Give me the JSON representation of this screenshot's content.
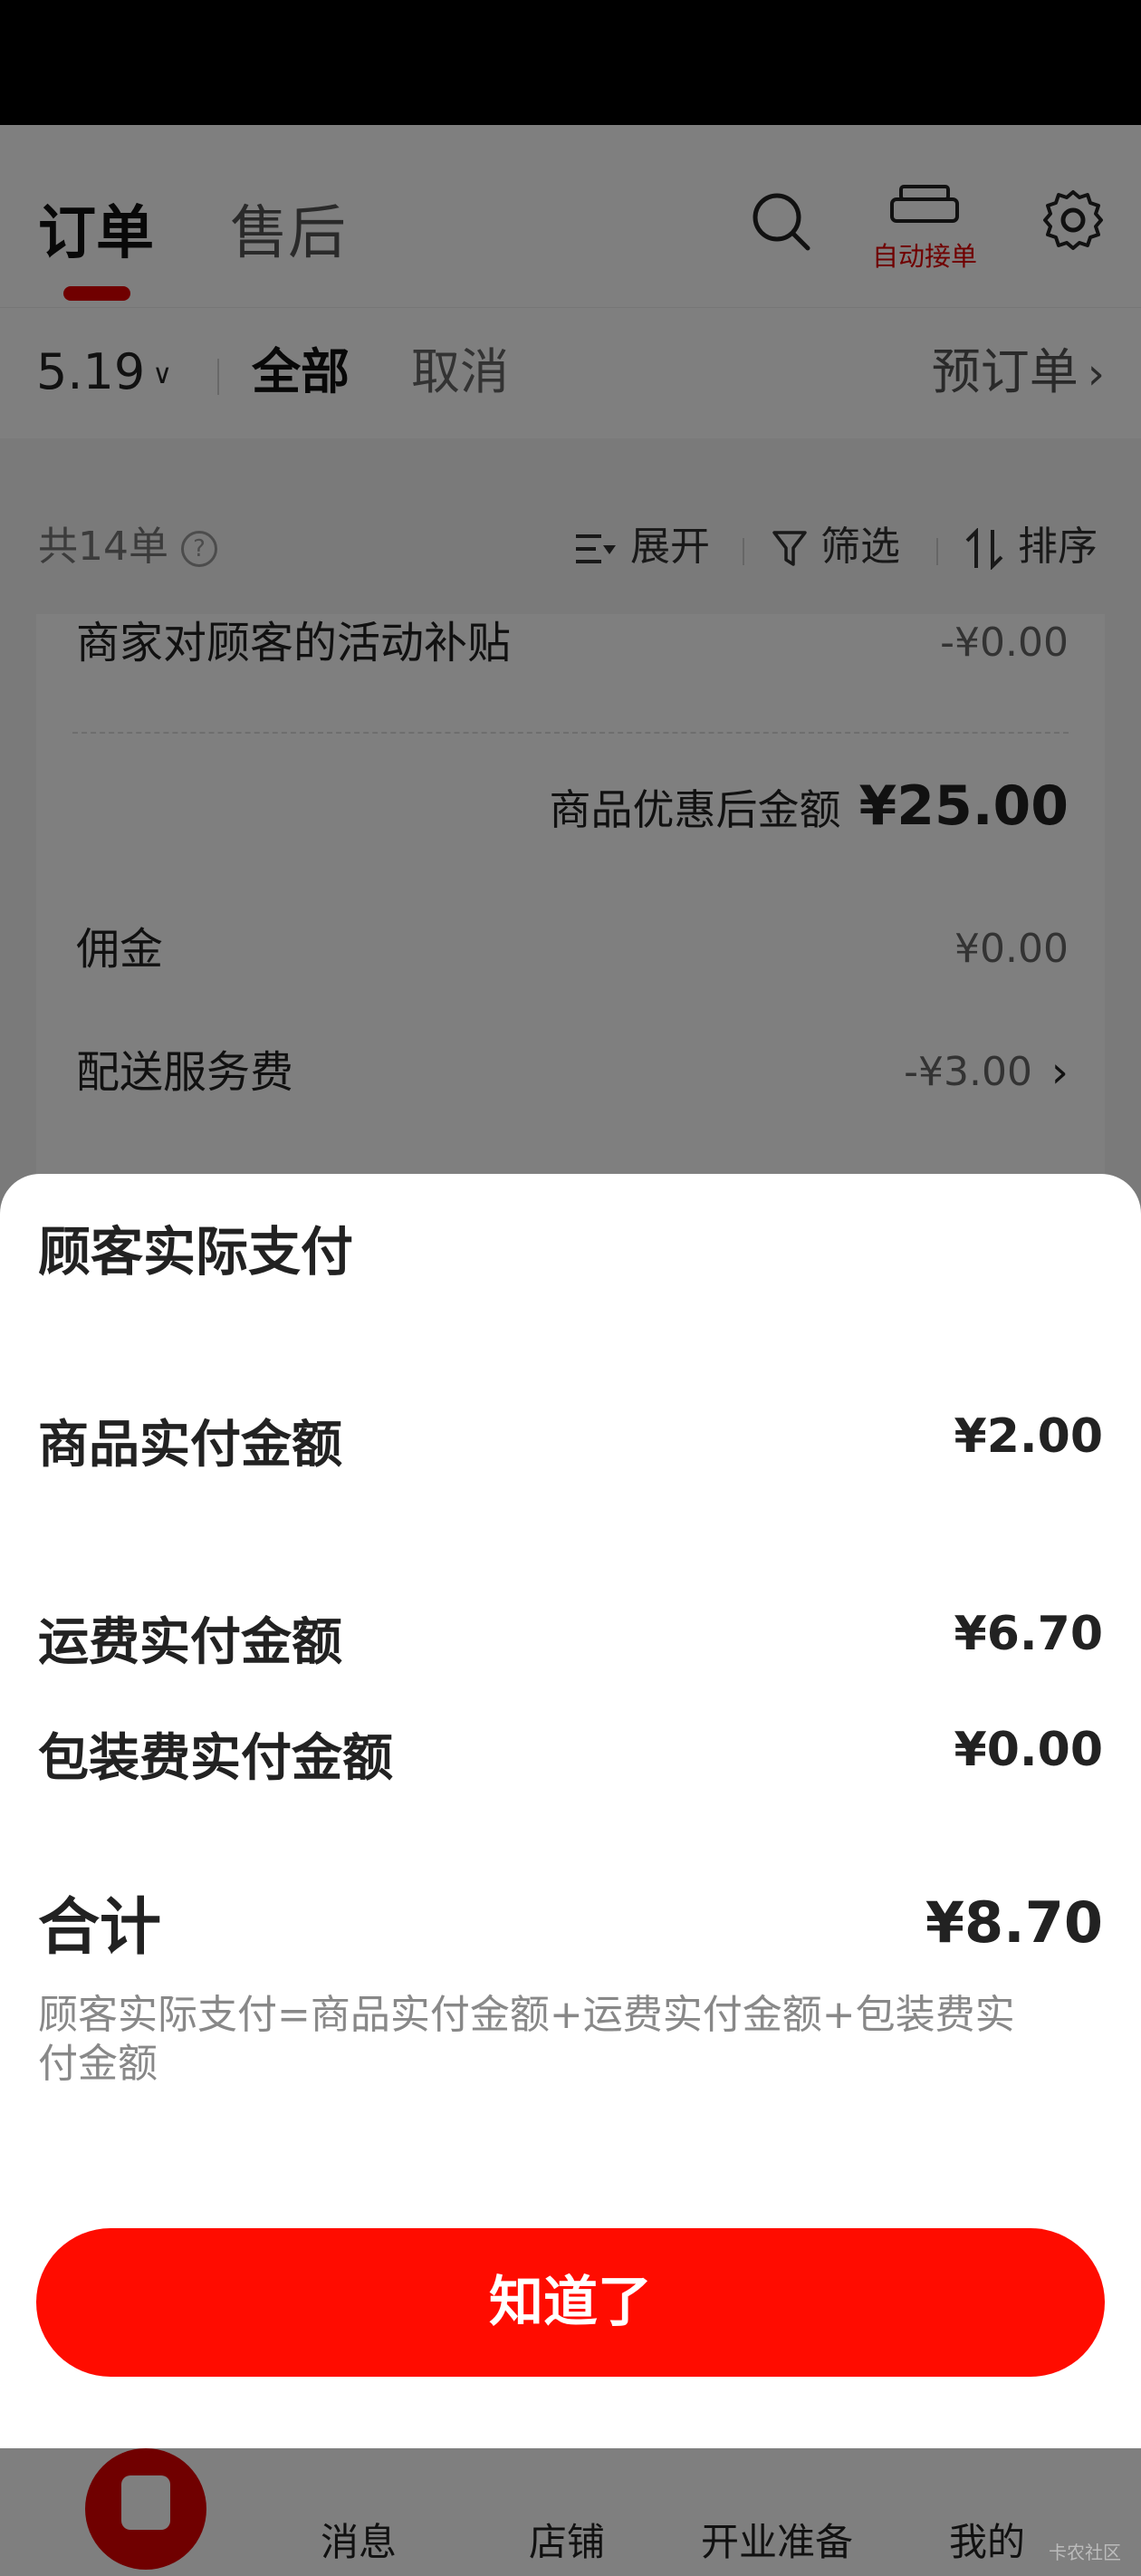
{
  "header": {
    "tabs": [
      "订单",
      "售后"
    ],
    "auto_accept_label": "自动接单"
  },
  "filters": {
    "date": "5.19",
    "all": "全部",
    "cancel": "取消",
    "preorder": "预订单"
  },
  "summary": {
    "count": "共14单",
    "expand": "展开",
    "filter": "筛选",
    "sort": "排序"
  },
  "order_card": {
    "subsidy_label": "商家对顾客的活动补贴",
    "subsidy_value": "-¥0.00",
    "discounted_label": "商品优惠后金额",
    "discounted_value": "¥25.00",
    "commission_label": "佣金",
    "commission_value": "¥0.00",
    "delivery_label": "配送服务费",
    "delivery_value": "-¥3.00"
  },
  "bottom_nav": [
    "消息",
    "店铺",
    "开业准备",
    "我的"
  ],
  "sheet": {
    "title": "顾客实际支付",
    "lines": [
      {
        "label": "商品实付金额",
        "value": "¥2.00"
      },
      {
        "label": "运费实付金额",
        "value": "¥6.70"
      },
      {
        "label": "包装费实付金额",
        "value": "¥0.00"
      }
    ],
    "total_label": "合计",
    "total_value": "¥8.70",
    "formula": "顾客实际支付=商品实付金额+运费实付金额+包装费实付金额",
    "confirm": "知道了"
  },
  "watermark": "卡农社区",
  "colors": {
    "accent": "#e00000",
    "button": "#ff0c00"
  }
}
